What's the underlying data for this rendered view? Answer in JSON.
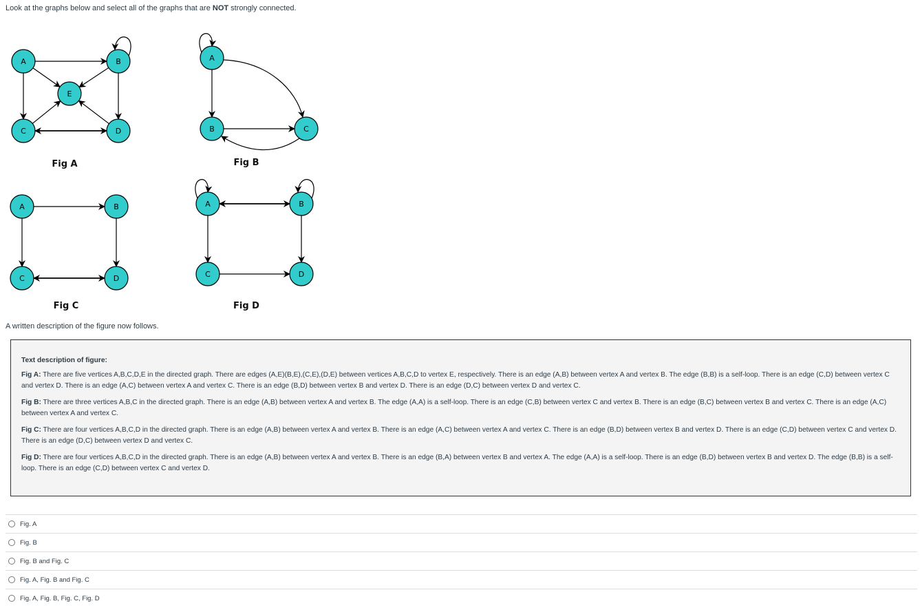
{
  "question": {
    "prefix": "Look at the graphs below and select all of the graphs that are ",
    "emph": "NOT",
    "suffix": " strongly connected."
  },
  "colors": {
    "node_fill": "#33cccc",
    "stroke": "#000000"
  },
  "figures": [
    {
      "label": "Fig A",
      "nodes": [
        "A",
        "B",
        "C",
        "D",
        "E"
      ],
      "edges": [
        [
          "A",
          "B"
        ],
        [
          "A",
          "C"
        ],
        [
          "A",
          "E"
        ],
        [
          "B",
          "E"
        ],
        [
          "B",
          "D"
        ],
        [
          "C",
          "E"
        ],
        [
          "D",
          "E"
        ],
        [
          "C",
          "D"
        ],
        [
          "D",
          "C"
        ],
        [
          "B",
          "B"
        ]
      ]
    },
    {
      "label": "Fig B",
      "nodes": [
        "A",
        "B",
        "C"
      ],
      "edges": [
        [
          "A",
          "A"
        ],
        [
          "A",
          "B"
        ],
        [
          "A",
          "C"
        ],
        [
          "B",
          "C"
        ],
        [
          "C",
          "B"
        ]
      ]
    },
    {
      "label": "Fig C",
      "nodes": [
        "A",
        "B",
        "C",
        "D"
      ],
      "edges": [
        [
          "A",
          "B"
        ],
        [
          "A",
          "C"
        ],
        [
          "B",
          "D"
        ],
        [
          "C",
          "D"
        ],
        [
          "D",
          "C"
        ]
      ]
    },
    {
      "label": "Fig D",
      "nodes": [
        "A",
        "B",
        "C",
        "D"
      ],
      "edges": [
        [
          "A",
          "A"
        ],
        [
          "B",
          "B"
        ],
        [
          "A",
          "B"
        ],
        [
          "B",
          "A"
        ],
        [
          "A",
          "C"
        ],
        [
          "B",
          "D"
        ],
        [
          "C",
          "D"
        ]
      ]
    }
  ],
  "intro": "A written description of the figure now follows.",
  "description": {
    "heading": "Text description of figure:",
    "items": [
      {
        "label": "Fig A:",
        "text": " There are five vertices A,B,C,D,E in the directed graph. There are edges (A,E)(B,E),(C,E),(D,E) between vertices A,B,C,D to vertex E, respectively. There is an edge (A,B) between vertex A and vertex B. The edge (B,B) is a self-loop. There is an edge (C,D) between vertex C and vertex D. There is an edge (A,C) between vertex A and vertex C. There is an edge (B,D) between vertex B and vertex D. There is an edge (D,C) between vertex D and vertex C."
      },
      {
        "label": "Fig B:",
        "text": " There are three vertices A,B,C in the directed graph. There is an edge (A,B) between vertex A and vertex B. The edge (A,A) is a self-loop. There is an edge (C,B) between vertex C and vertex B. There is an edge (B,C) between vertex B and vertex C. There is an edge (A,C) between vertex A and vertex C."
      },
      {
        "label": "Fig C:",
        "text": " There are four vertices A,B,C,D in the directed graph. There is an edge (A,B) between vertex A and vertex B. There is an edge (A,C) between vertex A and vertex C. There is an edge (B,D) between vertex B and vertex D. There is an edge (C,D) between vertex C and vertex D. There is an edge (D,C) between vertex D and vertex C."
      },
      {
        "label": "Fig D:",
        "text": " There are four vertices A,B,C,D in the directed graph. There is an edge (A,B) between vertex A and vertex B. There is an edge (B,A) between vertex B and vertex A. The edge (A,A) is a self-loop. There is an edge (B,D) between vertex B and vertex D. The edge (B,B) is a self-loop. There is an edge (C,D) between vertex C and vertex D."
      }
    ]
  },
  "options": [
    "Fig. A",
    "Fig. B",
    "Fig. B and Fig. C",
    "Fig. A, Fig. B and Fig. C",
    "Fig. A, Fig. B, Fig. C, Fig. D"
  ]
}
